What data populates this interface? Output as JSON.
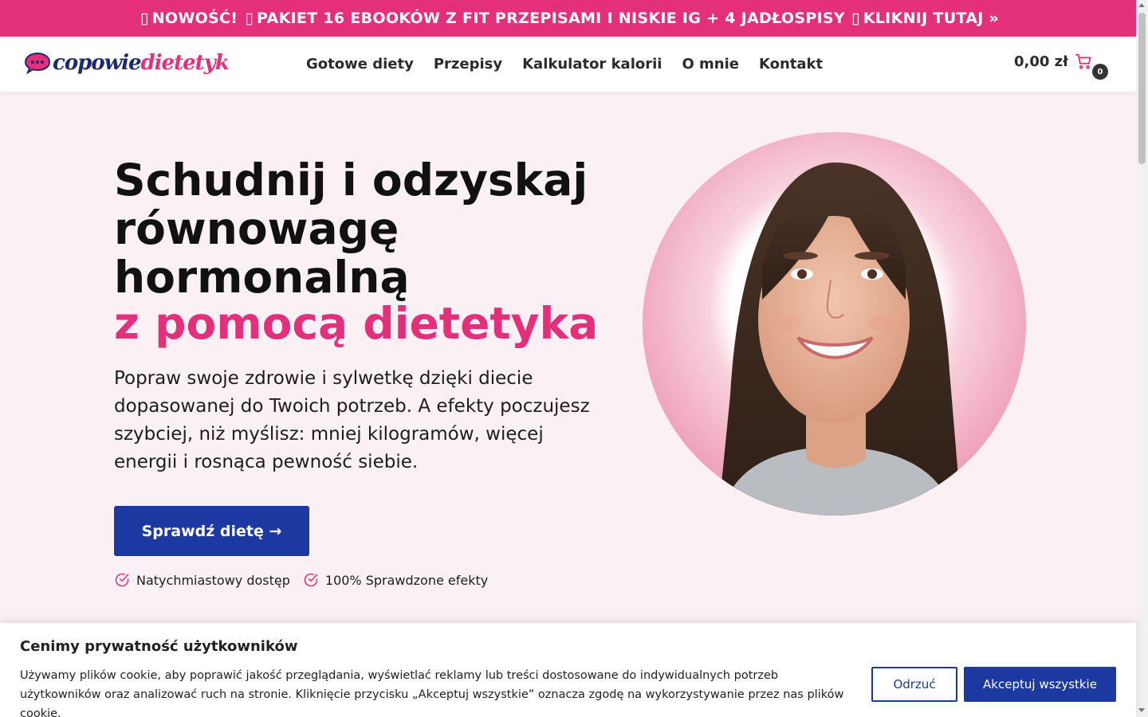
{
  "promo": {
    "glyph": "▯",
    "new_label": "NOWOŚĆ!",
    "offer_text": "PAKIET 16 EBOOKÓW Z FIT PRZEPISAMI I NISKIE IG + 4 JADŁOSPISY",
    "cta_text": "KLIKNIJ TUTAJ »"
  },
  "brand": {
    "logo_part1": "copowie",
    "logo_part2": "dietetyk",
    "accent_color": "#e4307a",
    "navy_color": "#1c2a6e"
  },
  "nav": {
    "items": [
      {
        "label": "Gotowe diety"
      },
      {
        "label": "Przepisy"
      },
      {
        "label": "Kalkulator kalorii"
      },
      {
        "label": "O mnie"
      },
      {
        "label": "Kontakt"
      }
    ]
  },
  "cart": {
    "price": "0,00 zł",
    "count": "0",
    "icon": "cart-icon"
  },
  "hero": {
    "title": "Schudnij i odzyskaj równowagę hormonalną",
    "title_accent": "z pomocą dietetyka",
    "description": "Popraw swoje zdrowie i sylwetkę dzięki diecie dopasowanej do Twoich potrzeb. A efekty poczujesz szybciej, niż myślisz: mniej kilogramów, więcej energii i rosnąca pewność siebie.",
    "cta_label": "Sprawdź dietę →",
    "button_color": "#1c38a1",
    "features": [
      {
        "label": "Natychmiastowy dostęp",
        "icon": "check-circle-icon"
      },
      {
        "label": "100% Sprawdzone efekty",
        "icon": "check-circle-icon"
      }
    ]
  },
  "cookie": {
    "title": "Cenimy prywatność użytkowników",
    "text": "Używamy plików cookie, aby poprawić jakość przeglądania, wyświetlać reklamy lub treści dostosowane do indywidualnych potrzeb użytkowników oraz analizować ruch na stronie. Kliknięcie przycisku „Akceptuj wszystkie” oznacza zgodę na wykorzystywanie przez nas plików cookie.",
    "reject_label": "Odrzuć",
    "accept_label": "Akceptuj wszystkie"
  }
}
